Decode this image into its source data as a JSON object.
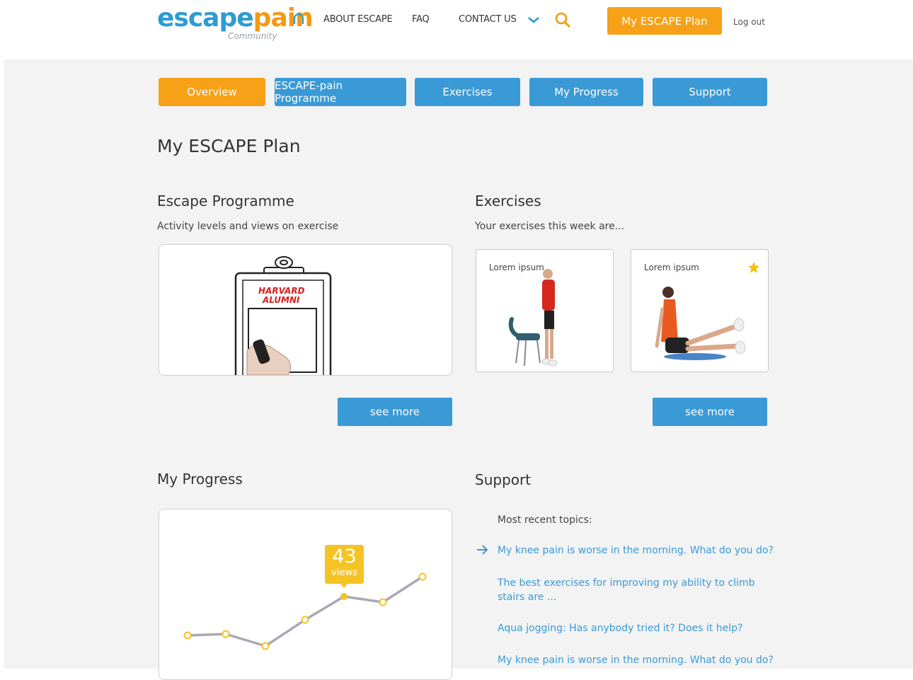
{
  "header": {
    "logo_main_1": "escape",
    "logo_main_2": "pain",
    "logo_sub": "Community",
    "nav": [
      "ABOUT ESCAPE",
      "FAQ",
      "CONTACT US"
    ],
    "plan_button": "My ESCAPE Plan",
    "logout": "Log out"
  },
  "tabs": [
    "Overview",
    "ESCAPE-pain  Programme",
    "Exercises",
    "My Progress",
    "Support"
  ],
  "page_title": "My ESCAPE Plan",
  "programme": {
    "title": "Escape Programme",
    "subtitle": "Activity levels and views on exercise",
    "video_text_1": "HARVARD",
    "video_text_2": "ALUMNI",
    "button": "see more"
  },
  "exercises": {
    "title": "Exercises",
    "subtitle": "Your exercises this week are...",
    "cards": [
      {
        "label": "Lorem ipsum",
        "starred": false
      },
      {
        "label": "Lorem ipsum",
        "starred": true
      }
    ],
    "button": "see more"
  },
  "progress": {
    "title": "My Progress",
    "tooltip_value": "43",
    "tooltip_unit": "views"
  },
  "support": {
    "title": "Support",
    "recent_label": "Most recent topics:",
    "topics": [
      "My knee pain is worse in the morning. What do you do?",
      "The best exercises for improving my ability to climb stairs are ...",
      "Aqua jogging: Has anybody tried it? Does it help?",
      "My knee pain is worse in the morning. What do you do?"
    ]
  },
  "colors": {
    "accent_orange": "#f7a118",
    "accent_blue": "#3a9ad5",
    "background": "#f3f3f3"
  }
}
